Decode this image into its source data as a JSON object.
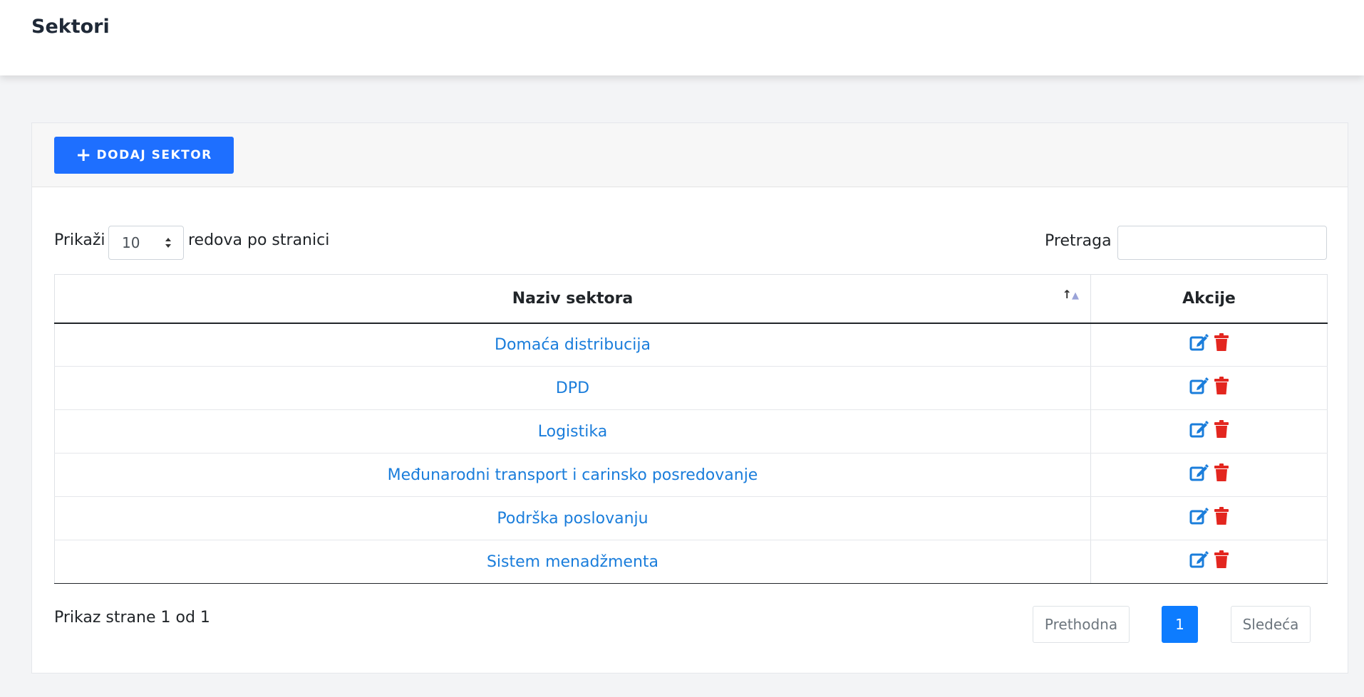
{
  "header": {
    "title": "Sektori"
  },
  "toolbar": {
    "add_label": "DODAJ SEKTOR",
    "add_icon": "plus-icon"
  },
  "controls": {
    "length_prefix": "Prikaži",
    "length_value": "10",
    "length_suffix": "redova po stranici",
    "search_label": "Pretraga",
    "search_value": ""
  },
  "table": {
    "columns": [
      "Naziv sektora",
      "Akcije"
    ],
    "rows": [
      "Domaća distribucija",
      "DPD",
      "Logistika",
      "Međunarodni transport i carinsko posredovanje",
      "Podrška poslovanju",
      "Sistem menadžmenta"
    ]
  },
  "footer": {
    "info": "Prikaz strane 1 od 1",
    "prev": "Prethodna",
    "page": "1",
    "next": "Sledeća"
  },
  "colors": {
    "primary": "#1e6fff",
    "link": "#1a7ddb",
    "edit_icon": "#1a7ddb",
    "delete_icon": "#e3261f"
  }
}
